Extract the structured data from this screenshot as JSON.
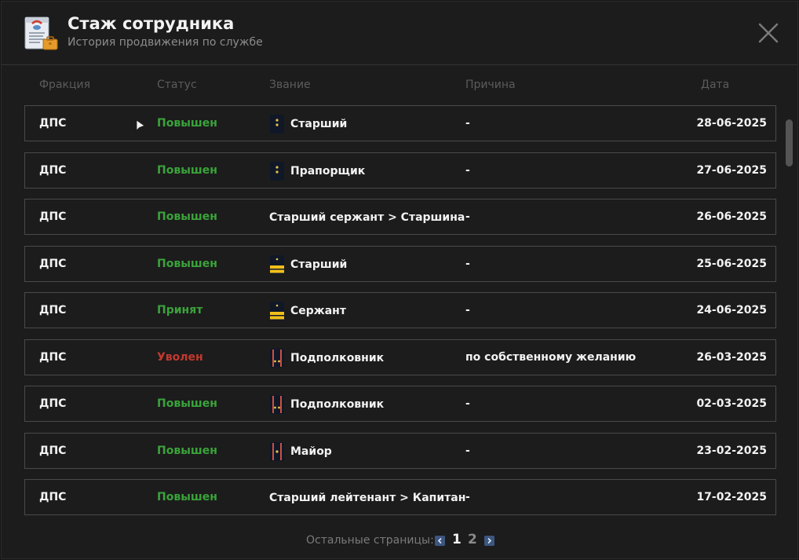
{
  "header": {
    "title": "Стаж сотрудника",
    "subtitle": "История продвижения по службе",
    "icon": "document-briefcase-icon"
  },
  "columns": {
    "faction": "Фракция",
    "status": "Статус",
    "rank": "Звание",
    "reason": "Причина",
    "date": "Дата"
  },
  "colors": {
    "promoted": "#3aa33a",
    "fired": "#c2392f",
    "accent": "#3d5680"
  },
  "rows": [
    {
      "faction": "ДПС",
      "status": "Повышен",
      "status_type": "green",
      "rank": "Старший",
      "badge": "dark-star",
      "reason": "-",
      "date": "28-06-2025"
    },
    {
      "faction": "ДПС",
      "status": "Повышен",
      "status_type": "green",
      "rank": "Прапорщик",
      "badge": "dark-star",
      "reason": "-",
      "date": "27-06-2025"
    },
    {
      "faction": "ДПС",
      "status": "Повышен",
      "status_type": "green",
      "rank": "Старший сержант > Старшина",
      "badge": "none",
      "reason": "-",
      "date": "26-06-2025"
    },
    {
      "faction": "ДПС",
      "status": "Повышен",
      "status_type": "green",
      "rank": "Старший",
      "badge": "gold-stripes",
      "reason": "-",
      "date": "25-06-2025"
    },
    {
      "faction": "ДПС",
      "status": "Принят",
      "status_type": "green",
      "rank": "Сержант",
      "badge": "gold-stripes",
      "reason": "-",
      "date": "24-06-2025"
    },
    {
      "faction": "ДПС",
      "status": "Уволен",
      "status_type": "red",
      "rank": "Подполковник",
      "badge": "red-double",
      "reason": "по собственному желанию",
      "date": "26-03-2025"
    },
    {
      "faction": "ДПС",
      "status": "Повышен",
      "status_type": "green",
      "rank": "Подполковник",
      "badge": "red-double",
      "reason": "-",
      "date": "02-03-2025"
    },
    {
      "faction": "ДПС",
      "status": "Повышен",
      "status_type": "green",
      "rank": "Майор",
      "badge": "red-single",
      "reason": "-",
      "date": "23-02-2025"
    },
    {
      "faction": "ДПС",
      "status": "Повышен",
      "status_type": "green",
      "rank": "Старший лейтенант > Капитан",
      "badge": "none",
      "reason": "-",
      "date": "17-02-2025"
    }
  ],
  "pagination": {
    "label": "Остальные страницы:",
    "pages": [
      "1",
      "2"
    ],
    "current": "1",
    "prev_icon": "chevron-left-icon",
    "next_icon": "chevron-right-icon"
  }
}
